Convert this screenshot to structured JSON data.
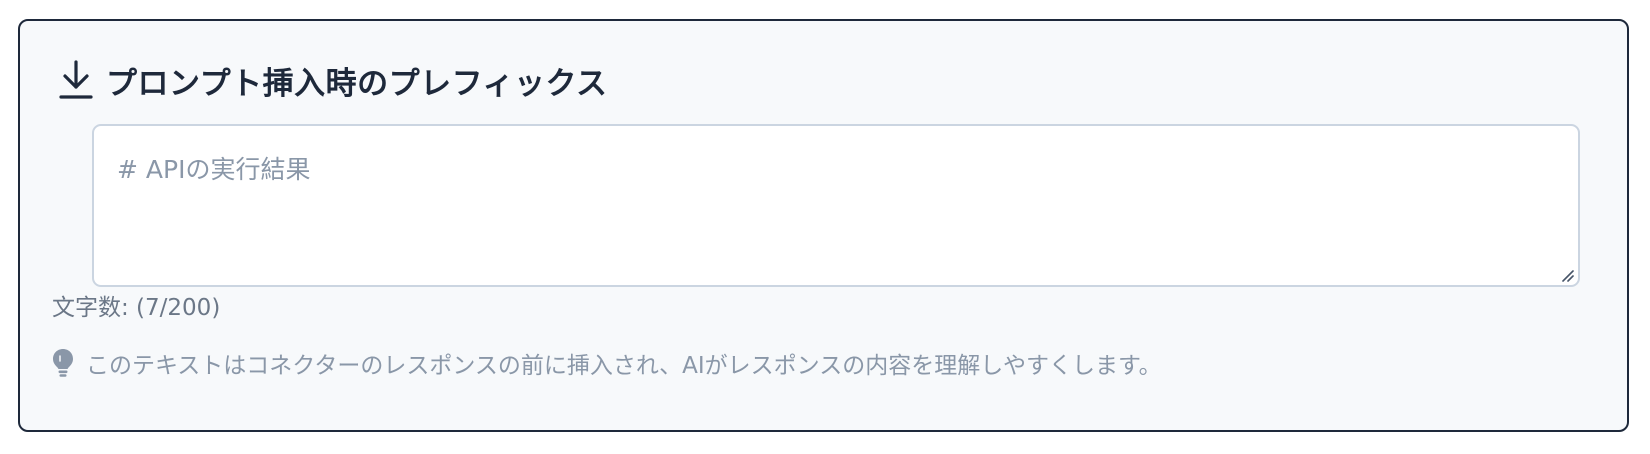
{
  "header": {
    "icon": "download-arrow-icon",
    "title": "プロンプト挿入時のプレフィックス"
  },
  "prefix_input": {
    "value": "",
    "placeholder": "# APIの実行結果"
  },
  "char_count": {
    "text": "文字数: (7/200)"
  },
  "hint": {
    "icon": "lightbulb-icon",
    "text": "このテキストはコネクターのレスポンスの前に挿入され、AIがレスポンスの内容を理解しやすくします。"
  },
  "colors": {
    "border": "#1e293b",
    "background": "#f7f9fb",
    "title": "#1e293b",
    "muted": "#8a97a8",
    "input_border": "#cbd5e1"
  }
}
